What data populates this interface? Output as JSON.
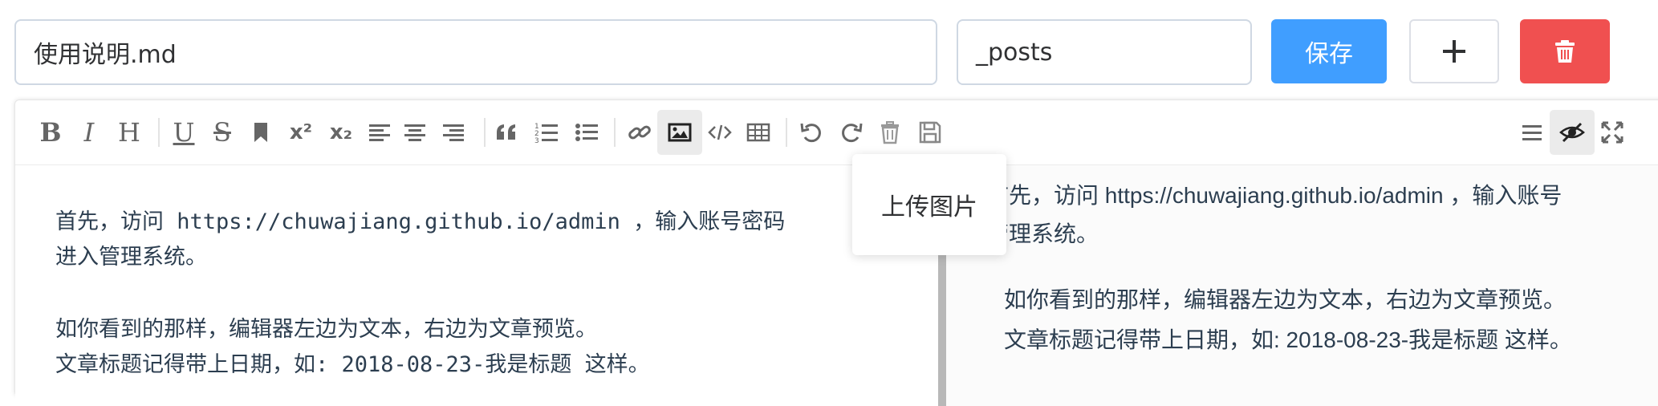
{
  "topbar": {
    "title_value": "使用说明.md",
    "dir_value": "_posts",
    "save_label": "保存"
  },
  "toolbar": {
    "bold": "B",
    "italic": "I",
    "header": "H",
    "underline": "U",
    "strike": "S",
    "superscript": "x²",
    "subscript": "x₂",
    "tooltip_upload_image": "上传图片"
  },
  "source": {
    "line1": "首先，访问 https://chuwajiang.github.io/admin ，输入账号密码",
    "line2": "进入管理系统。",
    "line3": "如你看到的那样，编辑器左边为文本，右边为文章预览。",
    "line4": "文章标题记得带上日期，如: 2018-08-23-我是标题 这样。"
  },
  "preview": {
    "line1": "首先，访问 https://chuwajiang.github.io/admin ，输入账号",
    "line2": "管理系统。",
    "line3": "如你看到的那样，编辑器左边为文本，右边为文章预览。",
    "line4": "文章标题记得带上日期，如: 2018-08-23-我是标题 这样。"
  },
  "icons": [
    "bold-icon",
    "italic-icon",
    "header-icon",
    "underline-icon",
    "strikethrough-icon",
    "mark-icon",
    "superscript-icon",
    "subscript-icon",
    "align-left-icon",
    "align-center-icon",
    "align-right-icon",
    "quote-icon",
    "ordered-list-icon",
    "unordered-list-icon",
    "link-icon",
    "image-icon",
    "code-icon",
    "table-icon",
    "undo-icon",
    "redo-icon",
    "trash-icon",
    "save-icon",
    "navigation-icon",
    "preview-toggle-icon",
    "fullscreen-icon"
  ],
  "colors": {
    "primary": "#409eff",
    "danger": "#f05050",
    "text": "#2c3e50",
    "icon": "#666666"
  }
}
